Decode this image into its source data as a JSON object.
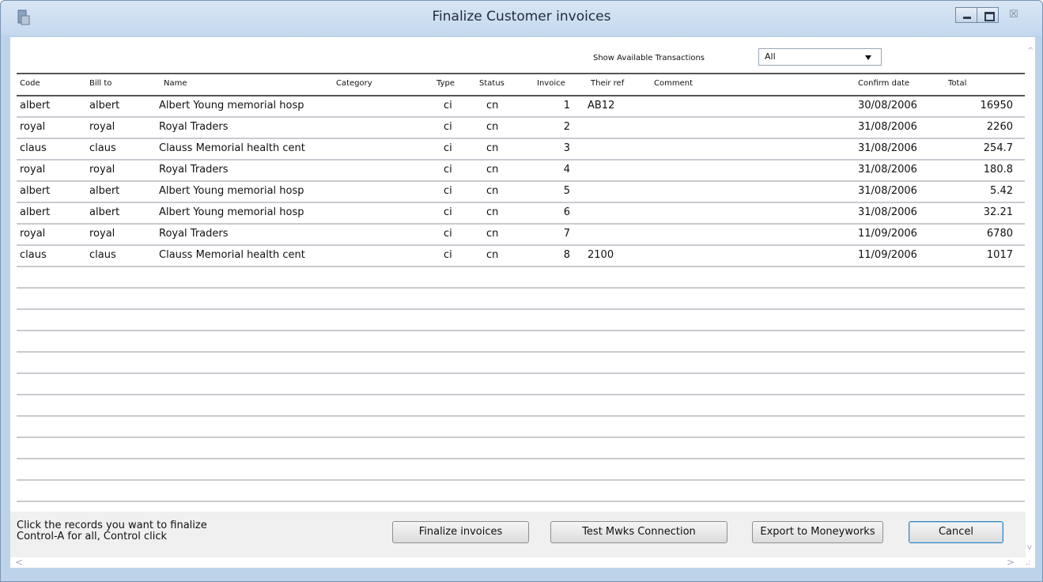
{
  "window": {
    "title": "Finalize Customer invoices",
    "close_glyph": "☒"
  },
  "filter": {
    "label": "Show Available Transactions",
    "selected": "All"
  },
  "columns": {
    "code": "Code",
    "bill_to": "Bill to",
    "name": "Name",
    "category": "Category",
    "type": "Type",
    "status": "Status",
    "invoice": "Invoice",
    "their_ref": "Their ref",
    "comment": "Comment",
    "confirm_date": "Confirm date",
    "total": "Total"
  },
  "rows": [
    {
      "code": "albert",
      "bill_to": "albert",
      "name": "Albert Young memorial hosp",
      "category": "",
      "type": "ci",
      "status": "cn",
      "invoice": "1",
      "their_ref": "AB12",
      "comment": "",
      "confirm_date": "30/08/2006",
      "total": "16950"
    },
    {
      "code": "royal",
      "bill_to": "royal",
      "name": "Royal Traders",
      "category": "",
      "type": "ci",
      "status": "cn",
      "invoice": "2",
      "their_ref": "",
      "comment": "",
      "confirm_date": "31/08/2006",
      "total": "2260"
    },
    {
      "code": "claus",
      "bill_to": "claus",
      "name": "Clauss Memorial health cent",
      "category": "",
      "type": "ci",
      "status": "cn",
      "invoice": "3",
      "their_ref": "",
      "comment": "",
      "confirm_date": "31/08/2006",
      "total": "254.7"
    },
    {
      "code": "royal",
      "bill_to": "royal",
      "name": "Royal Traders",
      "category": "",
      "type": "ci",
      "status": "cn",
      "invoice": "4",
      "their_ref": "",
      "comment": "",
      "confirm_date": "31/08/2006",
      "total": "180.8"
    },
    {
      "code": "albert",
      "bill_to": "albert",
      "name": "Albert Young memorial hosp",
      "category": "",
      "type": "ci",
      "status": "cn",
      "invoice": "5",
      "their_ref": "",
      "comment": "",
      "confirm_date": "31/08/2006",
      "total": "5.42"
    },
    {
      "code": "albert",
      "bill_to": "albert",
      "name": "Albert Young memorial hosp",
      "category": "",
      "type": "ci",
      "status": "cn",
      "invoice": "6",
      "their_ref": "",
      "comment": "",
      "confirm_date": "31/08/2006",
      "total": "32.21"
    },
    {
      "code": "royal",
      "bill_to": "royal",
      "name": "Royal Traders",
      "category": "",
      "type": "ci",
      "status": "cn",
      "invoice": "7",
      "their_ref": "",
      "comment": "",
      "confirm_date": "11/09/2006",
      "total": "6780"
    },
    {
      "code": "claus",
      "bill_to": "claus",
      "name": "Clauss Memorial health cent",
      "category": "",
      "type": "ci",
      "status": "cn",
      "invoice": "8",
      "their_ref": "2100",
      "comment": "",
      "confirm_date": "11/09/2006",
      "total": "1017"
    }
  ],
  "empty_rows": 13,
  "help_text": "Click the records you want to finalize\nControl-A for all, Control click",
  "buttons": {
    "finalize": "Finalize invoices",
    "test": "Test Mwks Connection",
    "export": "Export to Moneyworks",
    "cancel": "Cancel"
  },
  "scroll_glyphs": {
    "up": "^",
    "down": "v",
    "left": "<",
    "right": ">",
    "grip": ".:"
  },
  "icons": {
    "app": "app-icon",
    "minimize": "minimize-icon",
    "maximize": "maximize-icon",
    "close": "close-icon",
    "dropdown": "chevron-down-icon"
  },
  "colors": {
    "title_bg": "#c4d8ee",
    "frame": "#bcd3ea",
    "cancel_focus": "#3c7fb1"
  }
}
